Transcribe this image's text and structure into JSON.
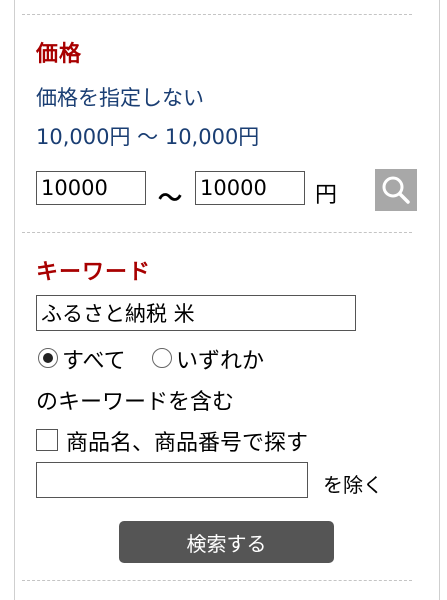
{
  "price": {
    "heading": "価格",
    "no_price_link": "価格を指定しない",
    "range_link": "10,000円 〜 10,000円",
    "min_value": "10000",
    "max_value": "10000",
    "tilde": "〜",
    "unit": "円",
    "search_icon": "magnifier-icon"
  },
  "keyword": {
    "heading": "キーワード",
    "value": "ふるさと納税 米",
    "radio_all_label": "すべて",
    "radio_any_label": "いずれか",
    "radio_selected": "すべて",
    "contains_label": "のキーワードを含む",
    "checkbox_label": "商品名、商品番号で探す",
    "checkbox_checked": false,
    "exclude_value": "",
    "exclude_label": "を除く",
    "submit_label": "検索する"
  },
  "colors": {
    "heading": "#a80000",
    "link": "#1a3e73",
    "search_button": "#a8a8a8",
    "submit_button": "#555555"
  }
}
